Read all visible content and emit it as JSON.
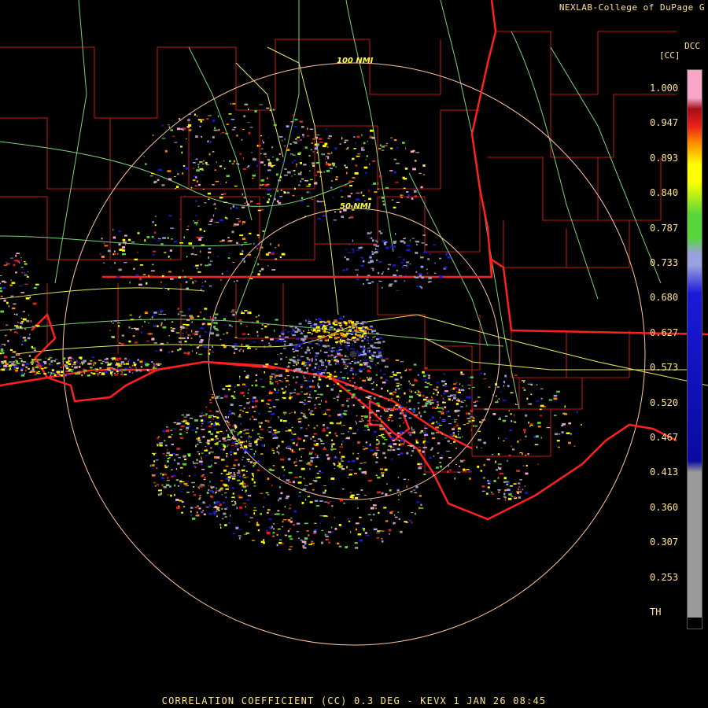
{
  "header": {
    "credit": "NEXLAB-College of DuPage G",
    "product_code": "DCC",
    "units": "[CC]"
  },
  "rings": {
    "outer_label": "100 NMI",
    "inner_label": "50 NMI"
  },
  "legend": {
    "labels": [
      "1.000",
      "0.947",
      "0.893",
      "0.840",
      "0.787",
      "0.733",
      "0.680",
      "0.627",
      "0.573",
      "0.520",
      "0.467",
      "0.413",
      "0.360",
      "0.307",
      "0.253",
      "TH"
    ],
    "colors": {
      "pink": "#f7a6c8",
      "dark_red": "#a50f15",
      "red": "#e8201a",
      "orange": "#ff8a00",
      "yellow": "#ffff00",
      "green": "#56d63a",
      "lavender": "#9aa0e0",
      "blue": "#1a1ad8",
      "navy": "#0a0aa0",
      "gray": "#9a9a9a"
    }
  },
  "map_colors": {
    "state_border": "#ff2020",
    "county_border": "#c81818",
    "highway_yellow": "#e6e65a",
    "highway_green": "#7ad27a",
    "range_ring": "#ffc49c"
  },
  "footer": {
    "caption": "CORRELATION COEFFICIENT (CC) 0.3 DEG - KEVX 1 JAN 26 08:45"
  }
}
